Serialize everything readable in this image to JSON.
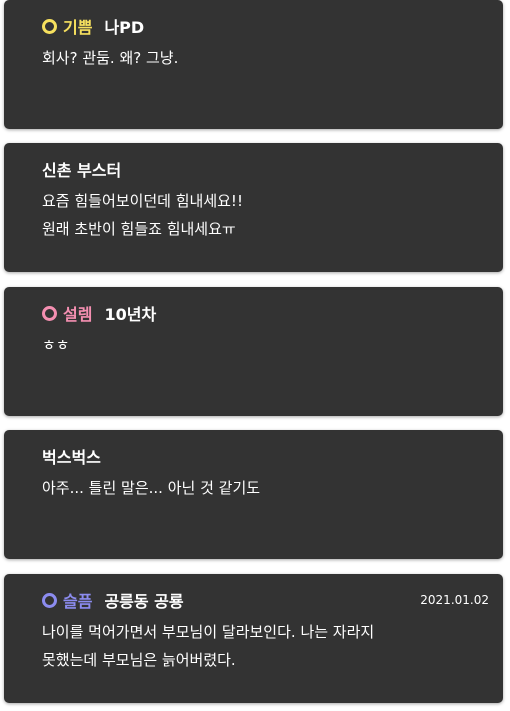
{
  "posts": [
    {
      "mood_label": "기쁨",
      "mood_color": "#f6e05e",
      "mood_icon": "circle-outline-icon",
      "author": "나PD",
      "date": "",
      "text": "회사? 관둠. 왜? 그냥."
    },
    {
      "mood_label": "",
      "mood_color": "",
      "mood_icon": "",
      "author": "신촌 부스터",
      "date": "",
      "text": "요즘 힘들어보이던데 힘내세요!!\n원래 초반이 힘들죠 힘내세요ㅠ"
    },
    {
      "mood_label": "설렘",
      "mood_color": "#f48fb1",
      "mood_icon": "circle-outline-icon",
      "author": "10년차",
      "date": "",
      "text": "ㅎㅎ"
    },
    {
      "mood_label": "",
      "mood_color": "",
      "mood_icon": "",
      "author": "벅스벅스",
      "date": "",
      "text": "아주... 틀린 말은... 아닌 것 같기도"
    },
    {
      "mood_label": "슬픔",
      "mood_color": "#8c8cf0",
      "mood_icon": "circle-outline-icon",
      "author": "공릉동 공룡",
      "date": "2021.01.02",
      "text": "나이를 먹어가면서 부모님이 달라보인다. 나는 자라지\n못했는데 부모님은 늙어버렸다."
    }
  ]
}
